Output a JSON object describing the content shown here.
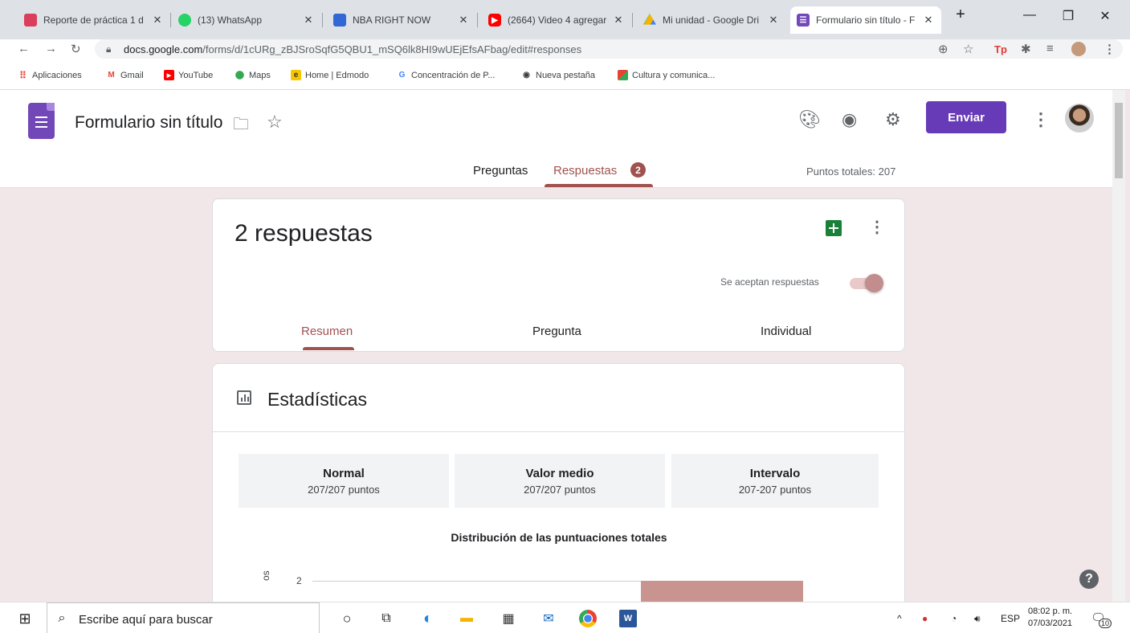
{
  "browser": {
    "tabs": [
      {
        "title": "Reporte de práctica 1 d",
        "icon": "slides-icon",
        "color": "#d93f5a"
      },
      {
        "title": "(13) WhatsApp",
        "icon": "whatsapp-icon",
        "color": "#25d366",
        "badge": "13"
      },
      {
        "title": "NBA RIGHT NOW",
        "icon": "news-icon",
        "color": "#3367d6"
      },
      {
        "title": "(2664) Video 4 agregar",
        "icon": "youtube-icon",
        "color": "#ff0000"
      },
      {
        "title": "Mi unidad - Google Dri",
        "icon": "drive-icon",
        "color": "#f4b400"
      },
      {
        "title": "Formulario sin título - F",
        "icon": "forms-icon",
        "color": "#7248b9"
      }
    ],
    "url_host": "docs.google.com",
    "url_path": "/forms/d/1cURg_zBJSroSqfG5QBU1_mSQ6lk8HI9wUEjEfsAFbag/edit#responses",
    "bookmarks": [
      {
        "label": "Aplicaciones",
        "icon": "apps-grid-icon",
        "color": "#ea4335"
      },
      {
        "label": "Gmail",
        "icon": "gmail-icon",
        "color": "#ea4335"
      },
      {
        "label": "YouTube",
        "icon": "youtube-icon",
        "color": "#ff0000"
      },
      {
        "label": "Maps",
        "icon": "maps-pin-icon",
        "color": "#34a853"
      },
      {
        "label": "Home | Edmodo",
        "icon": "edmodo-icon",
        "color": "#f7c600"
      },
      {
        "label": "Concentración de P...",
        "icon": "google-icon",
        "color": "#4285f4"
      },
      {
        "label": "Nueva pestaña",
        "icon": "globe-icon",
        "color": "#3c4043"
      },
      {
        "label": "Cultura y comunica...",
        "icon": "colorful-icon",
        "color": "#e94235"
      }
    ]
  },
  "form": {
    "title": "Formulario sin título",
    "send_label": "Enviar",
    "tabs": {
      "questions": "Preguntas",
      "responses": "Respuestas",
      "responses_badge": "2"
    },
    "total_points": "Puntos totales: 207",
    "accent": "#a0524f",
    "brand": "#673ab7"
  },
  "responses_card": {
    "count_text": "2 respuestas",
    "accepting_label": "Se aceptan respuestas",
    "subtabs": [
      "Resumen",
      "Pregunta",
      "Individual"
    ]
  },
  "stats_card": {
    "title": "Estadísticas",
    "boxes": [
      {
        "label": "Normal",
        "value": "207/207 puntos"
      },
      {
        "label": "Valor medio",
        "value": "207/207 puntos"
      },
      {
        "label": "Intervalo",
        "value": "207-207 puntos"
      }
    ],
    "chart_data": {
      "type": "bar",
      "title": "Distribución de las puntuaciones totales",
      "ylabel": "os",
      "yticks": [
        "2"
      ],
      "bar_color": "#c99390"
    }
  },
  "taskbar": {
    "search_placeholder": "Escribe aquí para buscar",
    "language": "ESP",
    "time": "08:02 p. m.",
    "date": "07/03/2021",
    "notifications": "10"
  }
}
